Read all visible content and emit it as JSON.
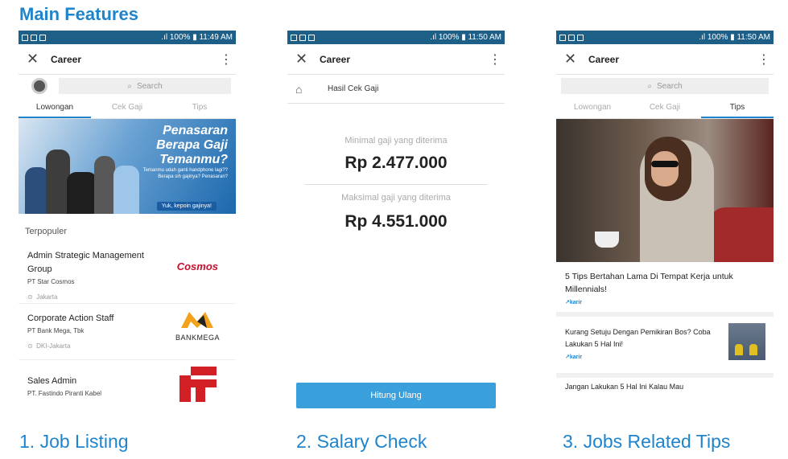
{
  "title": "Main Features",
  "statusbar": {
    "screen1": " .ıl 100% ▮ 11:49 AM",
    "screen2": " .ıl 100% ▮ 11:50 AM",
    "screen3": " .ıl 100% ▮ 11:50 AM"
  },
  "app": {
    "title": "Career",
    "close_icon": "close-icon",
    "more_icon": "more-vert-icon"
  },
  "search": {
    "placeholder": "Search"
  },
  "tabs": [
    "Lowongan",
    "Cek Gaji",
    "Tips"
  ],
  "job_listing": {
    "banner": {
      "headline": [
        "Penasaran",
        "Berapa Gaji",
        "Temanmu?"
      ],
      "subtext": "Temanmu udah ganti handphone lagi?? Berapa sih gajinya? Penasaran?",
      "cta": "Yuk, kepoin gajinya!"
    },
    "section_label": "Terpopuler",
    "jobs": [
      {
        "title": "Admin Strategic Management Group",
        "company": "PT Star Cosmos",
        "location": "Jakarta",
        "logo_text": "Cosmos"
      },
      {
        "title": "Corporate Action Staff",
        "company": "PT Bank Mega, Tbk",
        "location": "DKI-Jakarta",
        "logo_text": "BANKMEGA"
      },
      {
        "title": "Sales Admin",
        "company": "PT. Fastindo Piranti Kabel",
        "location": "",
        "logo_text": ""
      }
    ],
    "caption": "1. Job Listing"
  },
  "salary_check": {
    "header": "Hasil Cek Gaji",
    "min_label": "Minimal gaji yang diterima",
    "min_value": "Rp 2.477.000",
    "max_label": "Maksimal gaji yang diterima",
    "max_value": "Rp 4.551.000",
    "button": "Hitung Ulang",
    "caption": "2. Salary Check"
  },
  "tips": {
    "articles": [
      {
        "title": "5 Tips Bertahan Lama Di Tempat Kerja untuk Millennials!",
        "source": "karir"
      },
      {
        "title": "Kurang Setuju Dengan Pemikiran Bos? Coba Lakukan 5 Hal Ini!",
        "source": "karir"
      },
      {
        "title": "Jangan Lakukan 5 Hal Ini Kalau Mau",
        "source": ""
      }
    ],
    "caption": "3. Jobs Related Tips"
  },
  "colors": {
    "accent": "#1f84cc",
    "statusbar": "#1d5f87",
    "button": "#3aa0dc"
  }
}
